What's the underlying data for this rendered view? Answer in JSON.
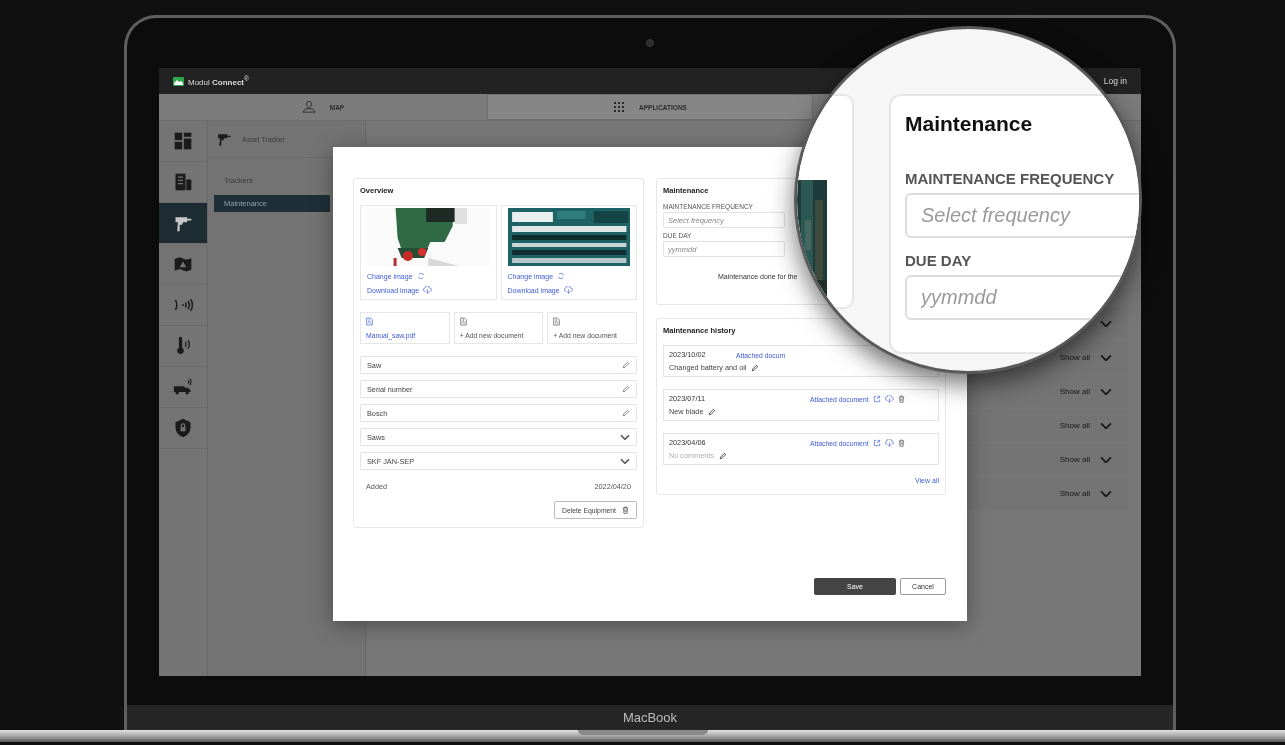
{
  "top_bar": {
    "logo": "Modul **Connect**$^{®}$",
    "login": "Log in"
  },
  "nav_tabs": [
    {
      "label": "MAP",
      "selected": false
    },
    {
      "label": "APPLICATIONS",
      "selected": true
    }
  ],
  "icon_rail": [
    {
      "selected": false
    },
    {
      "selected": false
    },
    {
      "selected": true
    },
    {
      "selected": false
    },
    {
      "selected": false
    },
    {
      "selected": false
    },
    {
      "selected": false
    },
    {
      "selected": false
    }
  ],
  "sidebar": {
    "title": "Asset Tracker",
    "items": [
      {
        "label": "Trackers",
        "selected": false
      },
      {
        "label": "Maintenance",
        "selected": true
      }
    ]
  },
  "list_rows": [
    {
      "kind": "chevron"
    },
    {
      "kind": "show_all",
      "label": "Show all"
    },
    {
      "kind": "show_all",
      "label": "Show all"
    },
    {
      "kind": "show_all",
      "label": "Show all"
    },
    {
      "kind": "show_all",
      "label": "Show all"
    },
    {
      "kind": "show_all",
      "label": "Show all"
    }
  ],
  "modal": {
    "overview": {
      "title": "Overview",
      "images": [
        {
          "kind": "tool",
          "change": "Change image",
          "download": "Download image"
        },
        {
          "kind": "label",
          "change": "Change image",
          "download": "Download image"
        }
      ],
      "documents": [
        {
          "kind": "file",
          "label": "Manual_saw.pdf"
        },
        {
          "kind": "add",
          "label": "+ Add new document"
        },
        {
          "kind": "add",
          "label": "+ Add new document"
        }
      ],
      "fields": [
        {
          "kind": "text",
          "value": "Saw"
        },
        {
          "kind": "text",
          "value": "Serial number"
        },
        {
          "kind": "text",
          "value": "Bosch"
        },
        {
          "kind": "select",
          "value": "Saws"
        },
        {
          "kind": "select",
          "value": "SKF JAN-SEP"
        }
      ],
      "added_label": "Added",
      "added_date": "2022/04/20",
      "delete_button": "Delete Equipment"
    },
    "maintenance": {
      "title": "Maintenance",
      "frequency_label": "MAINTENANCE FREQUENCY",
      "frequency_placeholder": "Select frequency",
      "due_label": "DUE DAY",
      "due_placeholder": "yymmdd",
      "done_text": "Maintenance done for the"
    },
    "history": {
      "title": "Maintenance history",
      "entries": [
        {
          "date": "2023/10/02",
          "comment": "Changed battery and oil",
          "empty": false,
          "link": "Attached docum",
          "show_actions": false
        },
        {
          "date": "2023/07/11",
          "comment": "New blade",
          "empty": false,
          "link": "Attached document",
          "show_actions": true
        },
        {
          "date": "2023/04/06",
          "comment": "No comments",
          "empty": true,
          "link": "Attached document",
          "show_actions": true
        }
      ],
      "view_all": "View all"
    },
    "buttons": {
      "save": "Save",
      "cancel": "Cancel"
    }
  },
  "magnifier": {
    "title": "Maintenance",
    "fields": [
      {
        "label": "MAINTENANCE FREQUENCY",
        "placeholder": "Select frequency"
      },
      {
        "label": "DUE DAY",
        "placeholder": "yymmdd"
      }
    ]
  },
  "device_label": "MacBook"
}
